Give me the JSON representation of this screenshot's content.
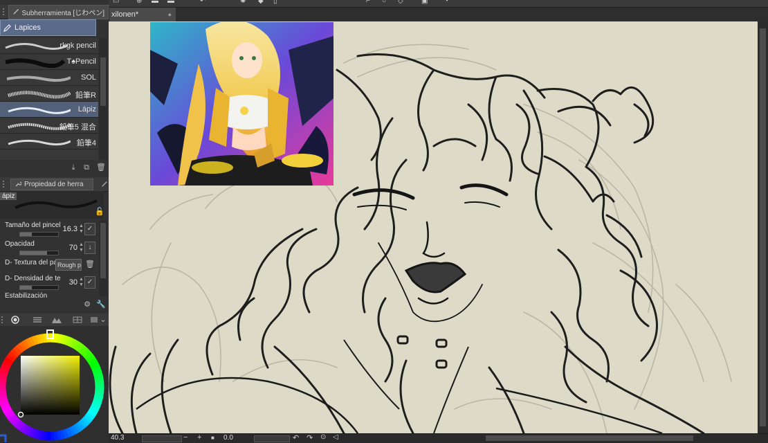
{
  "app": {
    "subtool_panel_title": "Subherramienta [じわペン]",
    "subtool_group": "Lapices",
    "tool_property_title": "Propiedad de herra",
    "document_tab": "xilonen*",
    "document_modified_marker": "●"
  },
  "brushes": [
    {
      "name": "rkgk pencil",
      "selected": false
    },
    {
      "name": "T♠Pencil",
      "selected": false
    },
    {
      "name": "SOL",
      "selected": false
    },
    {
      "name": "鉛筆R",
      "selected": false
    },
    {
      "name": "Lápiz",
      "selected": true
    },
    {
      "name": "鉛筆5 混合",
      "selected": false
    },
    {
      "name": "鉛筆4",
      "selected": false
    }
  ],
  "tool_property": {
    "preview_name": "ápiz",
    "rows": [
      {
        "label": "Tamaño del pincel",
        "value": "16.3",
        "level": 0.3
      },
      {
        "label": "Opacidad",
        "value": "70",
        "level": 0.7
      },
      {
        "label": "D- Textura del papel",
        "combo": "Rough p"
      },
      {
        "label": "D- Densidad de te",
        "value": "30",
        "level": 0.3
      },
      {
        "label": "Estabilización",
        "value": ""
      }
    ]
  },
  "status": {
    "zoom": "40.3",
    "rotation": "0.0"
  },
  "colors": {
    "canvas_bg": "#dddbc8",
    "selected_blue": "#5a6a8a",
    "panel_bg": "#323232",
    "current_color": "#2e5bd6"
  },
  "icons": [
    "new-layer-icon",
    "copy-icon",
    "trash-icon",
    "tool-settings-icon",
    "wrench-icon",
    "lock-icon"
  ]
}
